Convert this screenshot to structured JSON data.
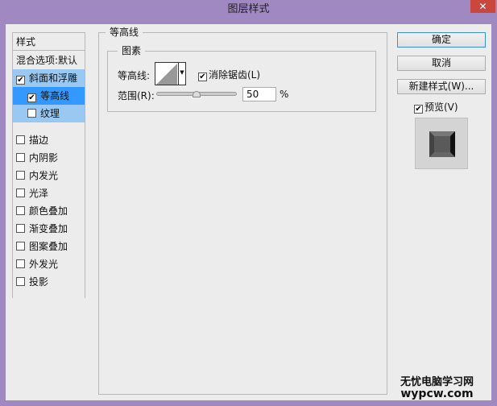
{
  "window": {
    "title": "图层样式"
  },
  "styles_list": {
    "header": "样式",
    "items": [
      {
        "label": "混合选项:默认",
        "checkbox": false,
        "checked": false
      },
      {
        "label": "斜面和浮雕",
        "checkbox": true,
        "checked": true
      },
      {
        "label": "等高线",
        "checkbox": true,
        "checked": true
      },
      {
        "label": "纹理",
        "checkbox": true,
        "checked": false
      },
      {
        "label": "描边",
        "checkbox": true,
        "checked": false
      },
      {
        "label": "内阴影",
        "checkbox": true,
        "checked": false
      },
      {
        "label": "内发光",
        "checkbox": true,
        "checked": false
      },
      {
        "label": "光泽",
        "checkbox": true,
        "checked": false
      },
      {
        "label": "颜色叠加",
        "checkbox": true,
        "checked": false
      },
      {
        "label": "渐变叠加",
        "checkbox": true,
        "checked": false
      },
      {
        "label": "图案叠加",
        "checkbox": true,
        "checked": false
      },
      {
        "label": "外发光",
        "checkbox": true,
        "checked": false
      },
      {
        "label": "投影",
        "checkbox": true,
        "checked": false
      }
    ]
  },
  "panel": {
    "title": "等高线",
    "group": "图素",
    "contour_label": "等高线:",
    "antialias_label": "消除锯齿(L)",
    "antialias_checked": true,
    "range_label": "范围(R):",
    "range_value": "50",
    "range_unit": "%",
    "range_percent": 50
  },
  "buttons": {
    "ok": "确定",
    "cancel": "取消",
    "new_style": "新建样式(W)...",
    "preview_label": "预览(V)",
    "preview_checked": true
  },
  "watermark": {
    "line1": "无忧电脑学习网",
    "line2": "wypcw.com"
  },
  "colors": {
    "selected": "#3399ff",
    "sub": "#99c9f3",
    "close": "#c9473d"
  }
}
